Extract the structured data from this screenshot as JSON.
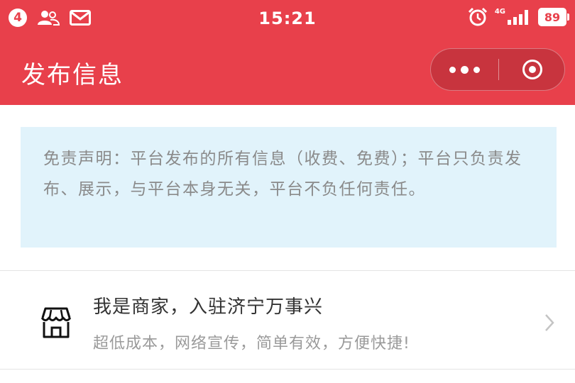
{
  "status_bar": {
    "notification_count": "4",
    "time": "15:21",
    "network": "4G",
    "battery": "89",
    "icons": [
      "contacts-icon",
      "mail-icon",
      "alarm-icon",
      "signal-icon"
    ]
  },
  "header": {
    "title": "发布信息",
    "background": "#e8404b"
  },
  "notice": {
    "text": "免责声明：平台发布的所有信息（收费、免费）；平台只负责发布、展示，与平台本身无关，平台不负任何责任。",
    "background": "#e1f3fb"
  },
  "merchant_entry": {
    "title": "我是商家，入驻济宁万事兴",
    "subtitle": "超低成本，网络宣传，简单有效，方便快捷!",
    "icon": "store-icon"
  }
}
